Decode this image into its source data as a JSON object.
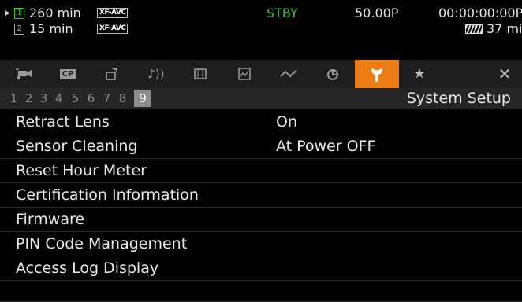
{
  "status": {
    "slot1": {
      "label": "1",
      "remaining": "260 min",
      "format": "XF-AVC"
    },
    "slot2": {
      "label": "2",
      "remaining": "15 min",
      "format": "XF-AVC"
    },
    "mode": "STBY",
    "frame_rate": "50.00P",
    "timecode": "00:00:00:00",
    "timecode_suffix": "P",
    "battery": "37 min",
    "colors": {
      "mode": "#3bc43b",
      "slot1": "#3bc43b"
    }
  },
  "tabs": [
    {
      "icon": "camera-setup-icon"
    },
    {
      "icon": "custom-picture-icon",
      "label": "CP"
    },
    {
      "icon": "recording-setup-icon"
    },
    {
      "icon": "audio-setup-icon"
    },
    {
      "icon": "display-setup-icon"
    },
    {
      "icon": "assistance-icon"
    },
    {
      "icon": "network-icon"
    },
    {
      "icon": "recording-media-icon"
    },
    {
      "icon": "wrench-icon",
      "active": true
    },
    {
      "icon": "my-menu-star-icon"
    },
    {
      "icon": "close-icon"
    }
  ],
  "pages": [
    "1",
    "2",
    "3",
    "4",
    "5",
    "6",
    "7",
    "8",
    "9"
  ],
  "selected_page": "9",
  "section_title": "System Setup",
  "menu": [
    {
      "label": "Retract Lens",
      "value": "On"
    },
    {
      "label": "Sensor Cleaning",
      "value": "At Power OFF"
    },
    {
      "label": "Reset Hour Meter",
      "value": ""
    },
    {
      "label": "Certification Information",
      "value": ""
    },
    {
      "label": "Firmware",
      "value": ""
    },
    {
      "label": "PIN Code Management",
      "value": ""
    },
    {
      "label": "Access Log Display",
      "value": ""
    }
  ],
  "accent_color": "#ee7c14"
}
